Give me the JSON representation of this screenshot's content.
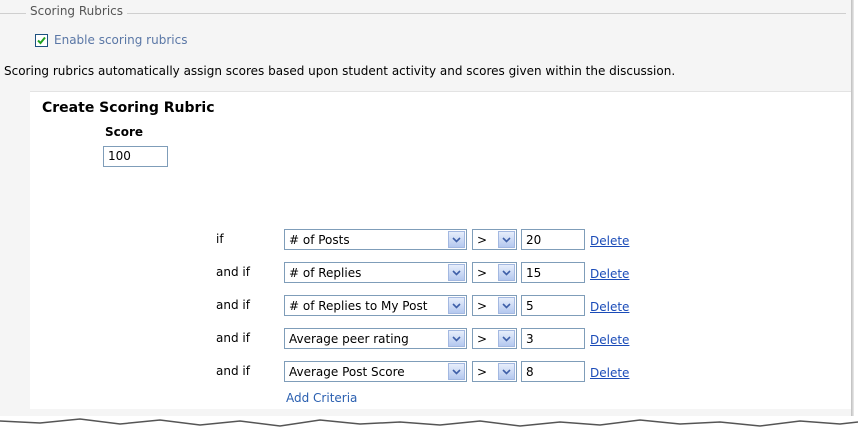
{
  "fieldset": {
    "legend": "Scoring Rubrics"
  },
  "enable": {
    "checked": true,
    "label": "Enable scoring rubrics"
  },
  "description": "Scoring rubrics automatically assign scores based upon student activity and scores given within the discussion.",
  "rubric": {
    "title": "Create Scoring Rubric",
    "score_label": "Score",
    "score_value": "100",
    "criteria": [
      {
        "condition": "if",
        "field": "# of Posts",
        "operator": ">",
        "value": "20",
        "delete_label": "Delete"
      },
      {
        "condition": "and if",
        "field": "# of Replies",
        "operator": ">",
        "value": "15",
        "delete_label": "Delete"
      },
      {
        "condition": "and if",
        "field": "# of Replies to My Post",
        "operator": ">",
        "value": "5",
        "delete_label": "Delete"
      },
      {
        "condition": "and if",
        "field": "Average peer rating",
        "operator": ">",
        "value": "3",
        "delete_label": "Delete"
      },
      {
        "condition": "and if",
        "field": "Average Post Score",
        "operator": ">",
        "value": "8",
        "delete_label": "Delete"
      }
    ],
    "add_criteria_label": "Add Criteria"
  }
}
